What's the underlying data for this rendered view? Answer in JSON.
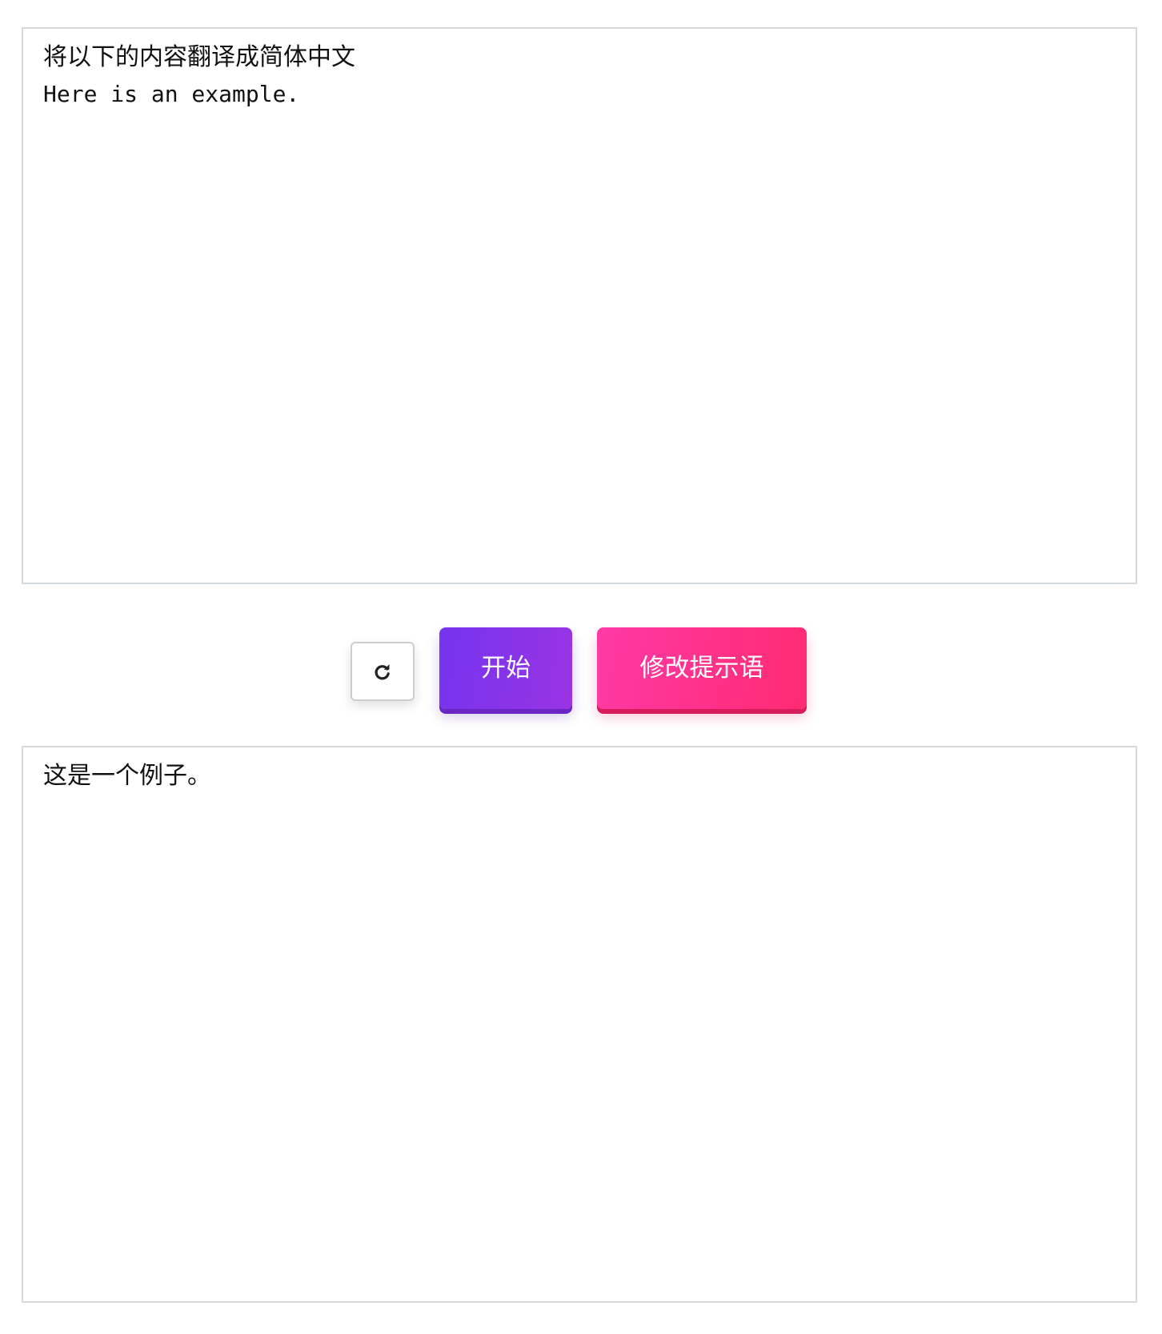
{
  "input_panel": {
    "prompt": "将以下的内容翻译成简体中文",
    "source_text": "Here is an example."
  },
  "controls": {
    "reload_icon": "reload-icon",
    "start_label": "开始",
    "edit_prompt_label": "修改提示语",
    "colors": {
      "start_gradient": [
        "#7434ee",
        "#9a34e4"
      ],
      "edit_gradient": [
        "#ff3aa6",
        "#ff2a72"
      ]
    }
  },
  "output_panel": {
    "result_text": "这是一个例子。"
  }
}
